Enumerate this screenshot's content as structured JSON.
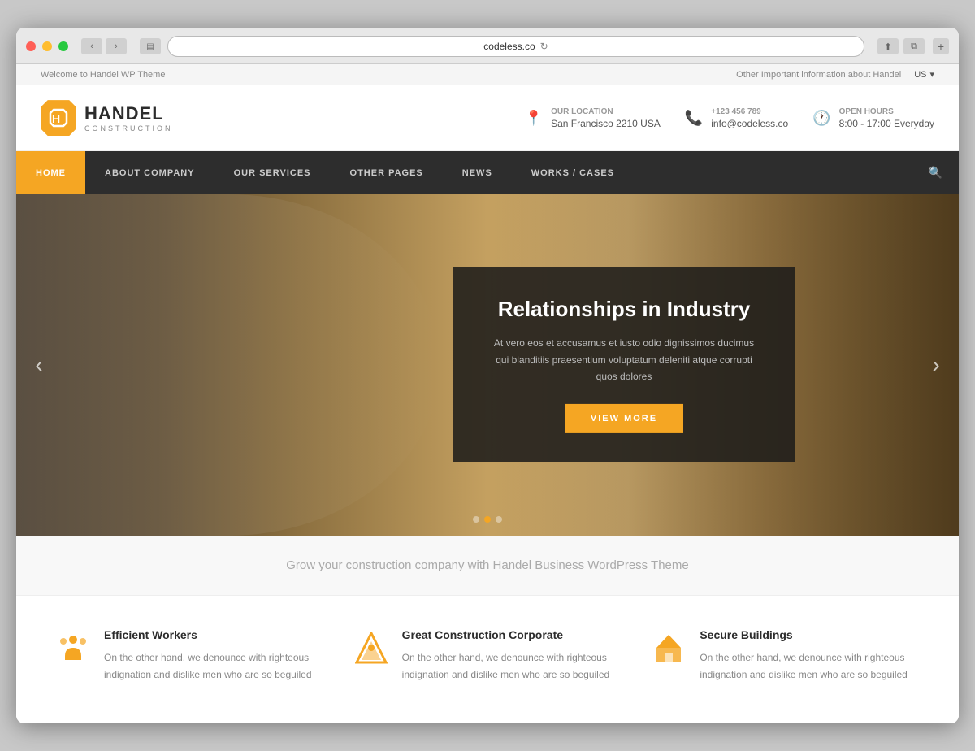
{
  "browser": {
    "url": "codeless.co",
    "dots": [
      "red",
      "yellow",
      "green"
    ]
  },
  "topBar": {
    "left": "Welcome to Handel WP Theme",
    "right": "Other Important information about Handel",
    "lang": "US"
  },
  "header": {
    "logo": {
      "icon": "H",
      "name": "HANDEL",
      "sub": "CONSTRUCTION"
    },
    "info": [
      {
        "icon": "📍",
        "label": "Our Location",
        "value": "San Francisco 2210 USA"
      },
      {
        "icon": "📞",
        "label": "+123 456 789",
        "value": "info@codeless.co"
      },
      {
        "icon": "🕐",
        "label": "Open Hours",
        "value": "8:00 - 17:00 Everyday"
      }
    ]
  },
  "nav": {
    "items": [
      {
        "label": "HOME",
        "active": true
      },
      {
        "label": "ABOUT COMPANY",
        "active": false
      },
      {
        "label": "OUR SERVICES",
        "active": false
      },
      {
        "label": "OTHER PAGES",
        "active": false
      },
      {
        "label": "NEWS",
        "active": false
      },
      {
        "label": "WORKS / CASES",
        "active": false
      }
    ]
  },
  "hero": {
    "title": "Relationships in Industry",
    "text": "At vero eos et accusamus et iusto odio dignissimos ducimus qui blanditiis praesentium voluptatum deleniti atque corrupti quos dolores",
    "button": "VIEW MORE",
    "dots": [
      false,
      true,
      false
    ]
  },
  "tagline": "Grow your construction company with Handel Business WordPress Theme",
  "features": [
    {
      "title": "Efficient Workers",
      "text": "On the other hand, we denounce with righteous indignation and dislike men who are so beguiled"
    },
    {
      "title": "Great Construction Corporate",
      "text": "On the other hand, we denounce with righteous indignation and dislike men who are so beguiled"
    },
    {
      "title": "Secure Buildings",
      "text": "On the other hand, we denounce with righteous indignation and dislike men who are so beguiled"
    }
  ]
}
